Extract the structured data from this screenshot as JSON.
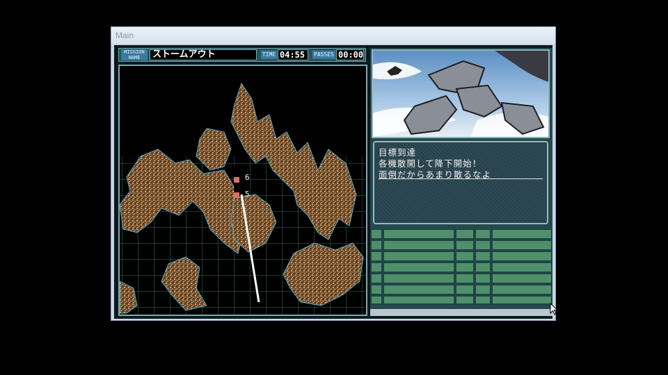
{
  "window": {
    "title": "Main"
  },
  "mission": {
    "name_tag_line1": "MISSION",
    "name_tag_line2": "NAME",
    "name": "ストームアウト",
    "time_tag": "TIME",
    "time": "04:55",
    "passes_tag": "PASSES",
    "passes": "00:00"
  },
  "map": {
    "units": [
      {
        "label": "6",
        "color": "#e06a6a"
      },
      {
        "label": "5",
        "color": "#e06a6a"
      }
    ]
  },
  "dialog": {
    "lines": [
      "目標到達",
      "各機散開して降下開始！",
      "面倒だからあまり散るなよ"
    ]
  },
  "colors": {
    "panel_bg": "#244a4e",
    "grid": "#2f7d5f",
    "terrain": "#b7864f",
    "tag": "#3a79a0"
  }
}
